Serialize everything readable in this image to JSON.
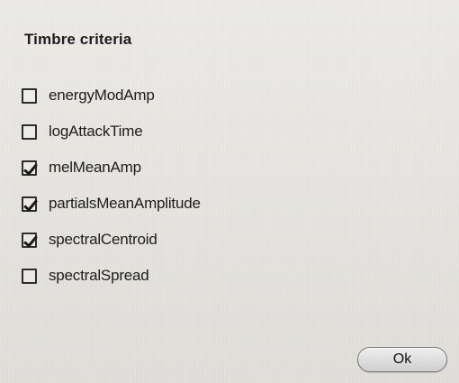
{
  "dialog": {
    "title": "Timbre criteria",
    "ok_label": "Ok",
    "items": [
      {
        "label": "energyModAmp",
        "checked": false
      },
      {
        "label": "logAttackTime",
        "checked": false
      },
      {
        "label": "melMeanAmp",
        "checked": true
      },
      {
        "label": "partialsMeanAmplitude",
        "checked": true
      },
      {
        "label": "spectralCentroid",
        "checked": true
      },
      {
        "label": "spectralSpread",
        "checked": false
      }
    ]
  },
  "theme": {
    "background": "#e7e6e1",
    "text": "#1d1d1d",
    "button_border": "#7a7a7a"
  }
}
